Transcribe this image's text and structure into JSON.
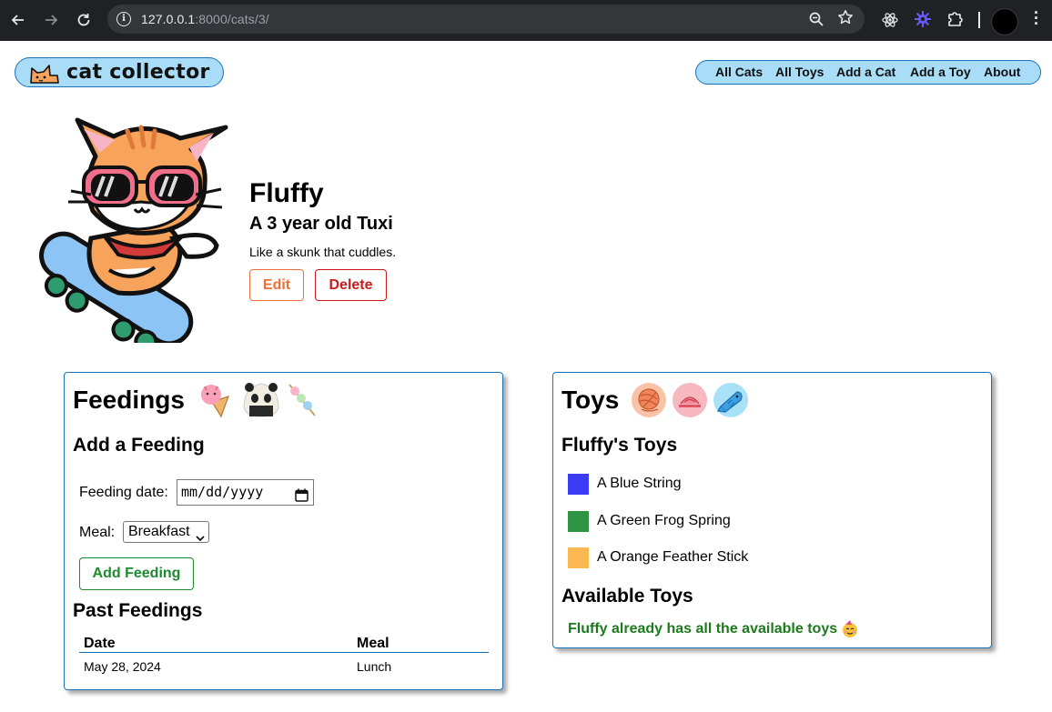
{
  "browser": {
    "url_host": "127.0.0.1",
    "url_rest": ":8000/cats/3/"
  },
  "header": {
    "logo_text": "cat collector",
    "nav": [
      "All Cats",
      "All Toys",
      "Add a Cat",
      "Add a Toy",
      "About"
    ]
  },
  "cat": {
    "name": "Fluffy",
    "subtitle": "A 3 year old Tuxi",
    "description": "Like a skunk that cuddles.",
    "edit_label": "Edit",
    "delete_label": "Delete"
  },
  "feedings": {
    "title": "Feedings",
    "add_heading": "Add a Feeding",
    "date_label": "Feeding date:",
    "date_placeholder": "mm/dd/yyyy",
    "meal_label": "Meal:",
    "meal_selected": "Breakfast",
    "add_button": "Add Feeding",
    "past_heading": "Past Feedings",
    "columns": [
      "Date",
      "Meal"
    ],
    "rows": [
      {
        "date": "May 28, 2024",
        "meal": "Lunch"
      }
    ]
  },
  "toys": {
    "title": "Toys",
    "owned_heading": "Fluffy's Toys",
    "owned": [
      {
        "name": "A Blue String",
        "color": "#3b3bf5"
      },
      {
        "name": "A Green Frog Spring",
        "color": "#2e9443"
      },
      {
        "name": "A Orange Feather Stick",
        "color": "#fbb751"
      }
    ],
    "available_heading": "Available Toys",
    "available_message": "Fluffy already has all the available toys"
  }
}
